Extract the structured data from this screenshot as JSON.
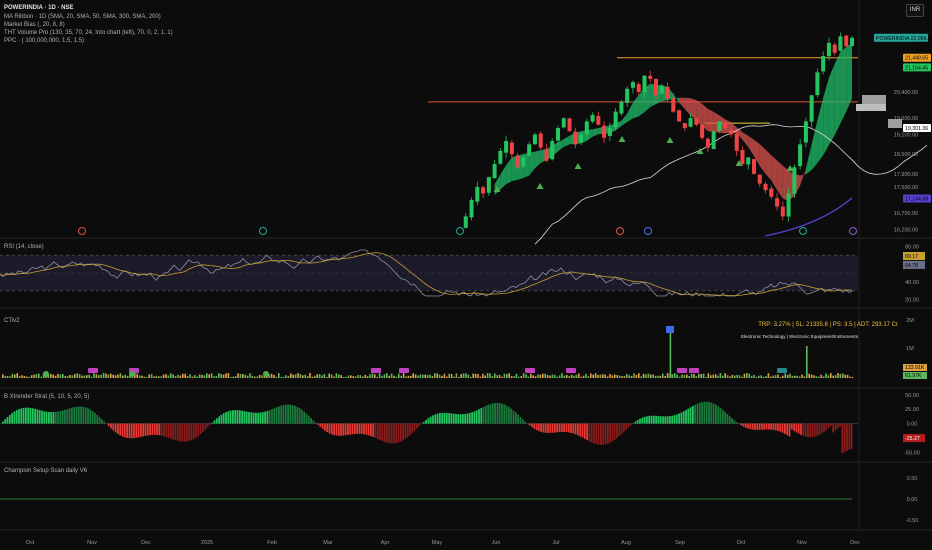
{
  "header": {
    "symbol_line": "POWERINDIA · 1D · NSE",
    "indicators": [
      "MA Ribbon · 1D (SMA, 20, SMA, 50, SMA, 300, SMA, 200)",
      "Market Bias (, 20, 8, 8)",
      "THT Volume Pro (130, 35, 70, 24, Into chart (left), 70, 0, 2, 1, 1)",
      "PPC · ( 100,000,000, 1.5, 1.5)"
    ],
    "currency": "INR"
  },
  "colors": {
    "up": "#22c55e",
    "down": "#ef4444",
    "ribbon_up": "#1fbf6a",
    "ribbon_down": "#d9534f",
    "rsi_line": "#8a8fa8",
    "rsi_ma": "#c8a030",
    "orange_line": "#f0a020",
    "red_line": "#e05030",
    "teal_label": "#26a69a",
    "purple_ma": "#5a3fd0"
  },
  "chart_data": [
    {
      "type": "candlestick",
      "panel": "price",
      "price_axis_ticks": [
        "20,400.00",
        "19,600.00",
        "19,100.00",
        "18,500.00",
        "17,900.00",
        "17,500.00",
        "16,700.00",
        "16,200.00"
      ],
      "price_labels": [
        {
          "text": "POWERINDIA",
          "value": "22,056.00",
          "color": "#26a69a"
        },
        {
          "text": "",
          "value": "21,448.65",
          "color": "#f0a020"
        },
        {
          "text": "",
          "value": "21,154.45",
          "color": "#22c55e"
        },
        {
          "text": "",
          "value": "19,301.36",
          "color": "#ffffff"
        },
        {
          "text": "",
          "value": "17,144.98",
          "color": "#5a3fd0"
        }
      ],
      "x_labels": [
        "Oct",
        "Nov",
        "Dec",
        "2025",
        "Feb",
        "Mar",
        "Apr",
        "May",
        "Jun",
        "Jul",
        "Aug",
        "Sep",
        "Oct",
        "Nov",
        "Dec"
      ],
      "closes": [
        16250,
        16600,
        17100,
        17500,
        17300,
        17800,
        18200,
        18600,
        18900,
        18500,
        18100,
        18400,
        18800,
        19100,
        18700,
        18300,
        18900,
        19300,
        19600,
        19200,
        18800,
        19100,
        19500,
        19700,
        19400,
        19000,
        19300,
        19800,
        20100,
        20500,
        20700,
        20400,
        20900,
        20800,
        20300,
        20600,
        20200,
        19800,
        19500,
        19300,
        19600,
        19400,
        19000,
        18700,
        19200,
        19500,
        19300,
        19100,
        18600,
        18200,
        18400,
        17900,
        17600,
        17400,
        17200,
        16900,
        16600,
        17300,
        18100,
        18800,
        19500,
        20300,
        21000,
        21500,
        21900,
        21600,
        22100,
        21800,
        22056
      ]
    },
    {
      "type": "line",
      "panel": "rsi",
      "title": "RSI (14, close)",
      "axis_ticks": [
        "80.00",
        "40.00",
        "20.00"
      ],
      "labels": [
        "69.17",
        "64.78"
      ]
    },
    {
      "type": "bar",
      "panel": "volume",
      "title": "CTiv2",
      "info": "TRP: 3.27% | SL: 21335.8 | PS: 3.5 | ADT: 293.17 Cr",
      "sector": "Electronic Technology | Electronic Equipment/Instruments",
      "axis_ticks": [
        "2M",
        "1M"
      ],
      "labels": [
        "133.91K",
        "61.97K"
      ]
    },
    {
      "type": "bar",
      "panel": "oscillator",
      "title": "B Xtrender Strat (5, 10, 5, 20, 5)",
      "axis_ticks": [
        "50.00",
        "25.00",
        "0.00",
        "-50.00"
      ],
      "last_value": "-25.27"
    },
    {
      "type": "line",
      "panel": "champion",
      "title": "Champion Setup Scan daily V6",
      "axis_ticks": [
        "0.50",
        "0.00",
        "-0.50"
      ]
    }
  ]
}
